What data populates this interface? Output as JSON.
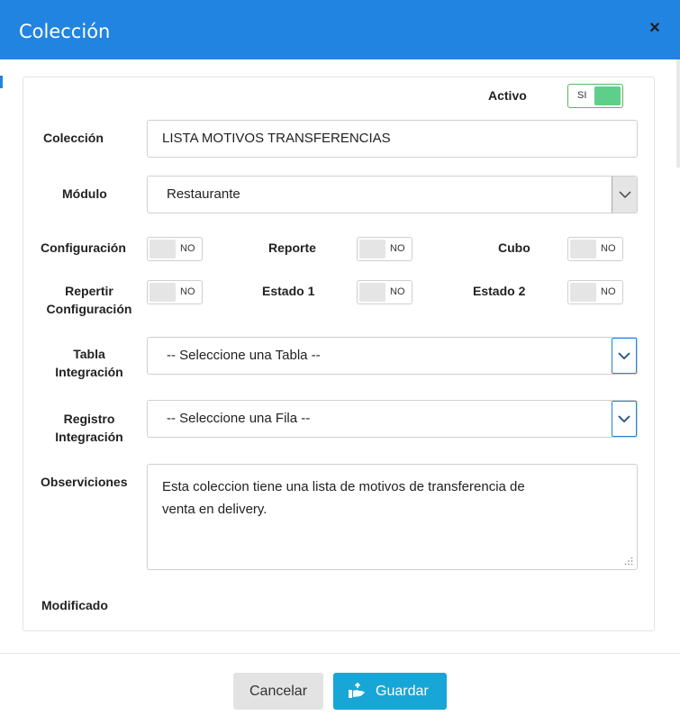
{
  "dialog": {
    "title": "Colección",
    "close_label": "×"
  },
  "activo": {
    "label": "Activo",
    "state": "SI"
  },
  "coleccion": {
    "label": "Colección",
    "value": "LISTA MOTIVOS TRANSFERENCIAS"
  },
  "modulo": {
    "label": "Módulo",
    "value": "Restaurante"
  },
  "toggles": {
    "configuracion": {
      "label": "Configuración",
      "state": "NO"
    },
    "reporte": {
      "label": "Reporte",
      "state": "NO"
    },
    "cubo": {
      "label": "Cubo",
      "state": "NO"
    },
    "repertir": {
      "label_line1": "Repertir",
      "label_line2": "Configuración",
      "state": "NO"
    },
    "estado1": {
      "label": "Estado 1",
      "state": "NO"
    },
    "estado2": {
      "label": "Estado 2",
      "state": "NO"
    }
  },
  "tabla": {
    "label_line1": "Tabla",
    "label_line2": "Integración",
    "value": "-- Seleccione una Tabla --"
  },
  "registro": {
    "label_line1": "Registro",
    "label_line2": "Integración",
    "value": "-- Seleccione una Fila --"
  },
  "observaciones": {
    "label": "Observiciones",
    "line1": "Esta coleccion tiene una lista de motivos de transferencia de",
    "line2": "venta en delivery."
  },
  "modificado": {
    "label": "Modificado"
  },
  "footer": {
    "cancel_label": "Cancelar",
    "save_label": "Guardar"
  },
  "colors": {
    "header": "#2184e0",
    "save_button": "#18a6d6",
    "toggle_on": "#5ecf8a"
  },
  "icons": {
    "close": "close-icon",
    "chevron": "chevron-down-icon",
    "save": "save-hand-icon",
    "resize": "resize-grip-icon"
  }
}
